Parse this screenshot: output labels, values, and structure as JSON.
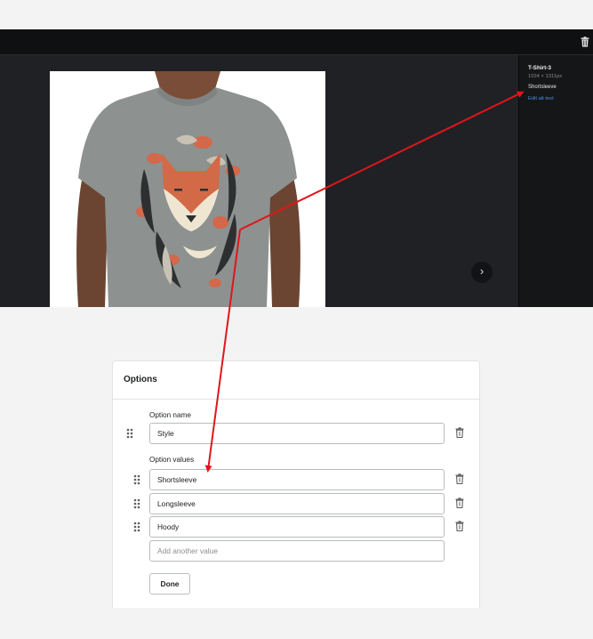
{
  "media": {
    "file_name": "T-Shirt-3",
    "dimensions": "1024 × 1311px",
    "alt_text": "Shortsleeve",
    "edit_alt_label": "Edit alt text",
    "next_icon": "chevron-right-icon",
    "delete_icon": "trash-icon"
  },
  "options": {
    "title": "Options",
    "option_name_label": "Option name",
    "option_name_value": "Style",
    "option_values_label": "Option values",
    "values": [
      "Shortsleeve",
      "Longsleeve",
      "Hoody"
    ],
    "add_placeholder": "Add another value",
    "done_label": "Done"
  },
  "annotation": {
    "arrow_color": "#e0161b"
  }
}
